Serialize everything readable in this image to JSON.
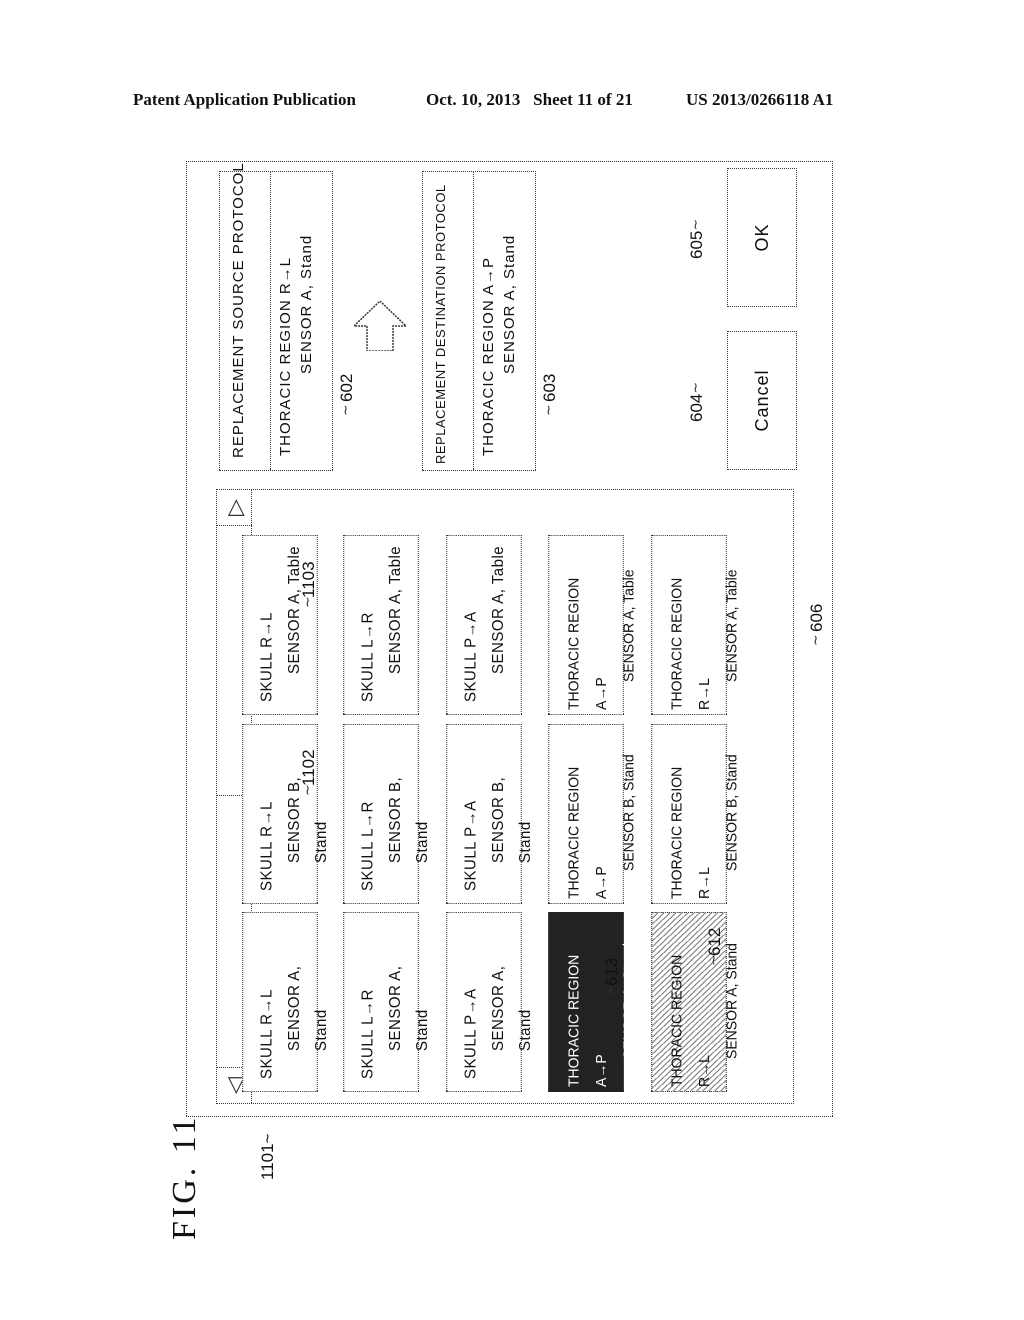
{
  "header": {
    "publication": "Patent Application Publication",
    "date_sheet": "Oct. 10, 2013   Sheet 11 of 21",
    "patent_number": "US 2013/0266118 A1"
  },
  "figure": {
    "title": "FIG. 11",
    "ref_dialog": "1101~",
    "ref_panel": "606",
    "ref_source": "602",
    "ref_destination": "603",
    "ref_cancel": "604",
    "ref_ok": "605",
    "ref_selected": "613",
    "ref_hatched": "612",
    "ref_col2": "1102",
    "ref_col3": "1103"
  },
  "dialog": {
    "source": {
      "title": "REPLACEMENT SOURCE PROTOCOL",
      "line1": "THORACIC REGION R→L",
      "line2": "SENSOR A, Stand"
    },
    "destination": {
      "title": "REPLACEMENT DESTINATION PROTOCOL",
      "line1": "THORACIC REGION A→P",
      "line2": "SENSOR A, Stand"
    },
    "arrow_icon": "right-arrow-icon",
    "buttons": {
      "cancel": "Cancel",
      "ok": "OK"
    },
    "scrollbar": {
      "left_icon": "◁",
      "right_icon": "▷"
    },
    "grid": {
      "columns": [
        {
          "group": "SENSOR A, Stand",
          "items": [
            {
              "line1": "SKULL R→L",
              "line2": "SENSOR A, Stand",
              "state": "normal"
            },
            {
              "line1": "SKULL L→R",
              "line2": "SENSOR A, Stand",
              "state": "normal"
            },
            {
              "line1": "SKULL P→A",
              "line2": "SENSOR A, Stand",
              "state": "normal"
            },
            {
              "line1": "THORACIC REGION A→P",
              "line2": "SENSOR A, Stand",
              "state": "selected"
            },
            {
              "line1": "THORACIC REGION R→L",
              "line2": "SENSOR A, Stand",
              "state": "hatched"
            }
          ]
        },
        {
          "group": "SENSOR B, Stand",
          "items": [
            {
              "line1": "SKULL R→L",
              "line2": "SENSOR B, Stand",
              "state": "normal"
            },
            {
              "line1": "SKULL L→R",
              "line2": "SENSOR B, Stand",
              "state": "normal"
            },
            {
              "line1": "SKULL P→A",
              "line2": "SENSOR B, Stand",
              "state": "normal"
            },
            {
              "line1": "THORACIC REGION A→P",
              "line2": "SENSOR B, Stand",
              "state": "normal"
            },
            {
              "line1": "THORACIC REGION R→L",
              "line2": "SENSOR B, Stand",
              "state": "normal"
            }
          ]
        },
        {
          "group": "SENSOR A, Table",
          "items": [
            {
              "line1": "SKULL R→L",
              "line2": "SENSOR A, Table",
              "state": "normal"
            },
            {
              "line1": "SKULL L→R",
              "line2": "SENSOR A, Table",
              "state": "normal"
            },
            {
              "line1": "SKULL P→A",
              "line2": "SENSOR A, Table",
              "state": "normal"
            },
            {
              "line1": "THORACIC REGION A→P",
              "line2": "SENSOR A, Table",
              "state": "normal"
            },
            {
              "line1": "THORACIC REGION R→L",
              "line2": "SENSOR A, Table",
              "state": "normal"
            }
          ]
        }
      ]
    }
  }
}
